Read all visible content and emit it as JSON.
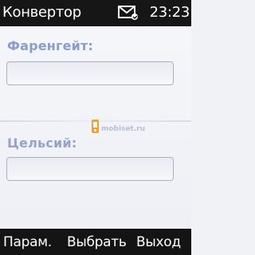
{
  "status_bar": {
    "title": "Конвертор",
    "time": "23:23",
    "icons": [
      "mail-icon"
    ]
  },
  "form": {
    "fahrenheit_label": "Фаренгейт:",
    "fahrenheit_value": "",
    "celsius_label": "Цельсий:",
    "celsius_value": ""
  },
  "watermark": {
    "text": "mobiset.ru"
  },
  "softkeys": {
    "left": "Парам.",
    "middle": "Выбрать",
    "right": "Выход"
  },
  "colors": {
    "bar_background": "#161616",
    "label_color": "#8a9dc8",
    "content_background": "#f1f2f6"
  }
}
